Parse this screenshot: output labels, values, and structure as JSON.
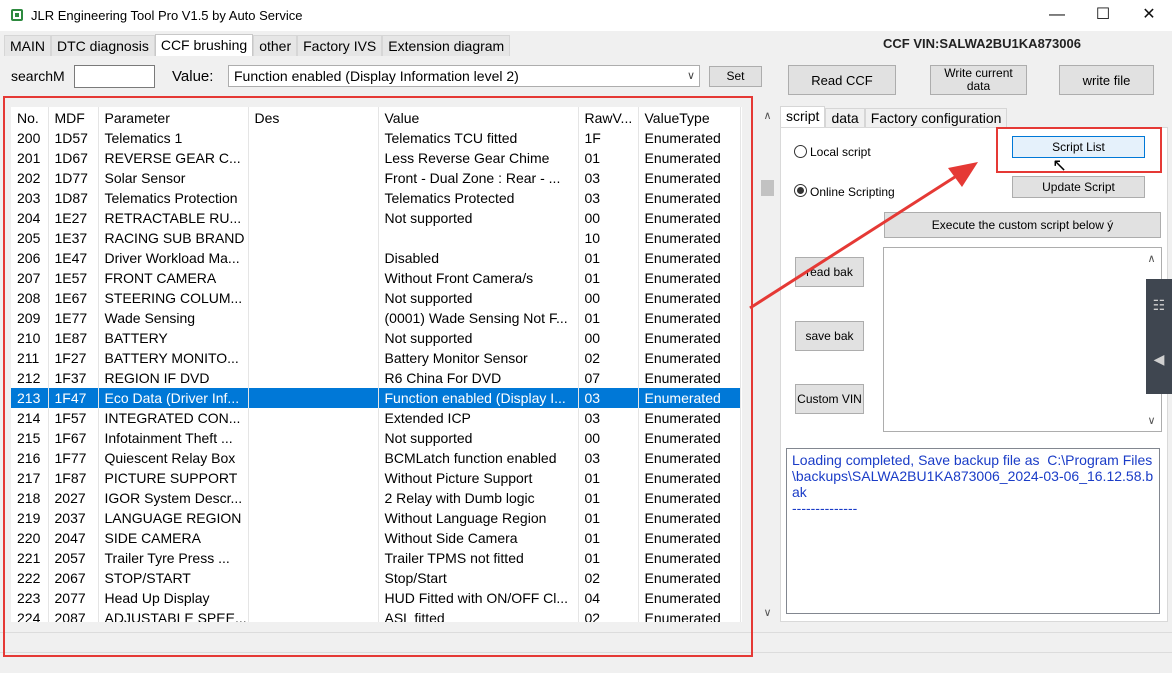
{
  "window": {
    "title": "JLR Engineering Tool Pro V1.5 by Auto Service",
    "minimize_glyph": "—",
    "maximize_glyph": "☐",
    "close_glyph": "✕"
  },
  "tabs": [
    "MAIN",
    "DTC diagnosis",
    "CCF brushing",
    "other",
    "Factory IVS",
    "Extension diagram"
  ],
  "active_tab": "CCF brushing",
  "ccf_vin": "CCF VIN:SALWA2BU1KA873006",
  "search": {
    "label": "searchM",
    "value": ""
  },
  "value_field": {
    "label": "Value:",
    "selected": "Function enabled (Display Information level 2)",
    "set_label": "Set"
  },
  "top_buttons": {
    "read_ccf": "Read CCF",
    "write_current_data": "Write current data",
    "write_file": "write file"
  },
  "table": {
    "columns": [
      "No.",
      "MDF",
      "Parameter",
      "Des",
      "Value",
      "RawV...",
      "ValueType"
    ],
    "selected_index": 13,
    "rows": [
      [
        "200",
        "1D57",
        "Telematics 1",
        "",
        "Telematics TCU fitted",
        "1F",
        "Enumerated"
      ],
      [
        "201",
        "1D67",
        "REVERSE GEAR C...",
        "",
        "Less Reverse Gear Chime",
        "01",
        "Enumerated"
      ],
      [
        "202",
        "1D77",
        "Solar Sensor",
        "",
        "Front - Dual Zone : Rear - ...",
        "03",
        "Enumerated"
      ],
      [
        "203",
        "1D87",
        "Telematics Protection",
        "",
        "Telematics Protected",
        "03",
        "Enumerated"
      ],
      [
        "204",
        "1E27",
        "RETRACTABLE RU...",
        "",
        "Not supported",
        "00",
        "Enumerated"
      ],
      [
        "205",
        "1E37",
        "RACING SUB BRAND",
        "",
        "",
        "10",
        "Enumerated"
      ],
      [
        "206",
        "1E47",
        "Driver Workload Ma...",
        "",
        "Disabled",
        "01",
        "Enumerated"
      ],
      [
        "207",
        "1E57",
        "FRONT CAMERA",
        "",
        "Without Front Camera/s",
        "01",
        "Enumerated"
      ],
      [
        "208",
        "1E67",
        "STEERING COLUM...",
        "",
        "Not supported",
        "00",
        "Enumerated"
      ],
      [
        "209",
        "1E77",
        "Wade Sensing",
        "",
        "(0001) Wade Sensing Not F...",
        "01",
        "Enumerated"
      ],
      [
        "210",
        "1E87",
        "BATTERY",
        "",
        "Not supported",
        "00",
        "Enumerated"
      ],
      [
        "211",
        "1F27",
        "BATTERY MONITO...",
        "",
        "Battery Monitor Sensor",
        "02",
        "Enumerated"
      ],
      [
        "212",
        "1F37",
        "REGION IF DVD",
        "",
        "R6 China For DVD",
        "07",
        "Enumerated"
      ],
      [
        "213",
        "1F47",
        "Eco Data (Driver Inf...",
        "",
        "Function enabled (Display I...",
        "03",
        "Enumerated"
      ],
      [
        "214",
        "1F57",
        "INTEGRATED CON...",
        "",
        "Extended ICP",
        "03",
        "Enumerated"
      ],
      [
        "215",
        "1F67",
        "Infotainment Theft ...",
        "",
        "Not supported",
        "00",
        "Enumerated"
      ],
      [
        "216",
        "1F77",
        "Quiescent Relay Box",
        "",
        "BCMLatch function enabled",
        "03",
        "Enumerated"
      ],
      [
        "217",
        "1F87",
        "PICTURE SUPPORT",
        "",
        "Without Picture Support",
        "01",
        "Enumerated"
      ],
      [
        "218",
        "2027",
        "IGOR System Descr...",
        "",
        "2 Relay with Dumb logic",
        "01",
        "Enumerated"
      ],
      [
        "219",
        "2037",
        "LANGUAGE REGION",
        "",
        "Without Language Region",
        "01",
        "Enumerated"
      ],
      [
        "220",
        "2047",
        "SIDE CAMERA",
        "",
        "Without Side Camera",
        "01",
        "Enumerated"
      ],
      [
        "221",
        "2057",
        "Trailer Tyre Press ...",
        "",
        "Trailer TPMS not fitted",
        "01",
        "Enumerated"
      ],
      [
        "222",
        "2067",
        "STOP/START",
        "",
        "Stop/Start",
        "02",
        "Enumerated"
      ],
      [
        "223",
        "2077",
        "Head Up Display",
        "",
        "HUD Fitted with ON/OFF Cl...",
        "04",
        "Enumerated"
      ],
      [
        "224",
        "2087",
        "ADJUSTABLE SPEE...",
        "",
        "ASL fitted",
        "02",
        "Enumerated"
      ]
    ]
  },
  "right_tabs": [
    "script",
    "data",
    "Factory configuration"
  ],
  "active_right_tab": "script",
  "script_panel": {
    "local_script": "Local script",
    "online_scripting": "Online Scripting",
    "online_selected": true,
    "script_list": "Script List",
    "update_script": "Update Script",
    "execute_custom": "Execute the custom script below ý",
    "read_bak": "read bak",
    "save_bak": "save bak",
    "custom_vin": "Custom VIN"
  },
  "log_lines": [
    "Loading completed, Save backup file as  C:\\Program Files\\backups\\SALWA2BU1KA873006_2024-03-06_16.12.58.bak",
    "--------------"
  ],
  "colors": {
    "selection": "#0078d7",
    "highlight_box": "#e53935",
    "log_text": "#1a3cc7"
  }
}
